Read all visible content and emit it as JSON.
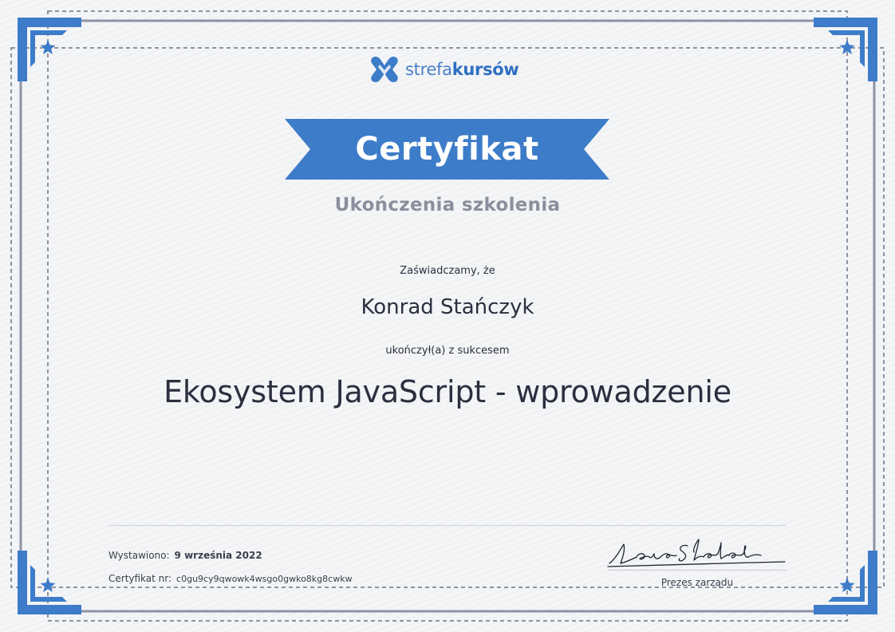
{
  "brand": {
    "name_part1": "strefa",
    "name_part2": "kursów",
    "accent_color": "#3d7cc9",
    "logo_icon": "strefakursow-logo-icon"
  },
  "certificate": {
    "title": "Certyfikat",
    "subtitle": "Ukończenia szkolenia",
    "certify_line": "Zaświadczamy, że",
    "recipient_name": "Konrad Stańczyk",
    "completed_line": "ukończył(a) z sukcesem",
    "course_name": "Ekosystem JavaScript - wprowadzenie"
  },
  "footer": {
    "issued_label": "Wystawiono:",
    "issued_date": "9 września 2022",
    "cert_no_label": "Certyfikat nr:",
    "cert_no": "c0gu9cy9qwowk4wsgo0gwko8kg8cwkw",
    "signer_title": "Prezes zarządu",
    "signature_text": "Łukasz Słoboda"
  },
  "colors": {
    "frame_blue": "#3d7cc9",
    "frame_gray": "#8d93a6",
    "text_dark": "#2b2f3f",
    "text_muted": "#8a8f9d"
  }
}
